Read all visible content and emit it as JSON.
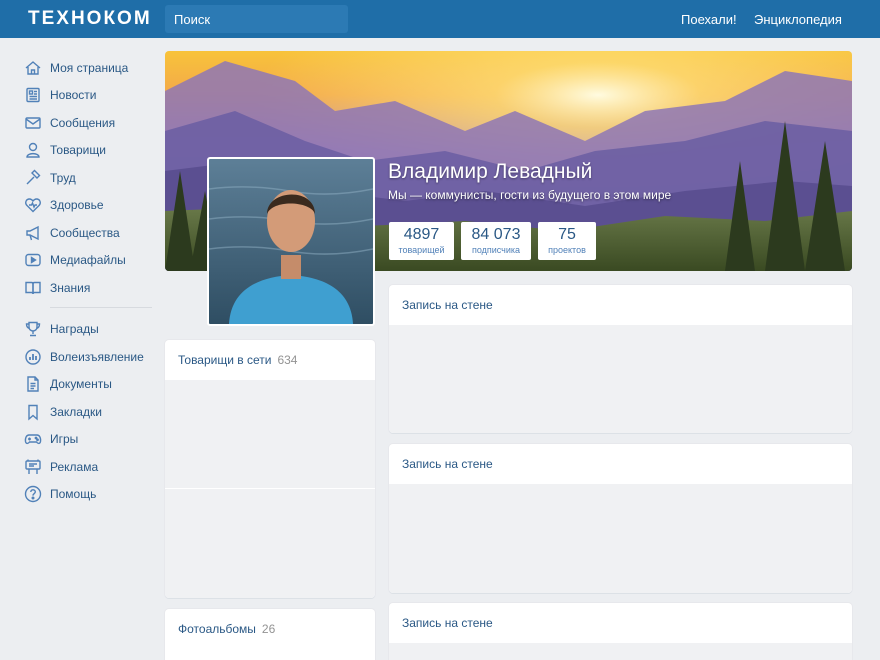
{
  "header": {
    "logo": "ТЕХНОКОМ",
    "search_placeholder": "Поиск",
    "links": [
      "Поехали!",
      "Энциклопедия"
    ]
  },
  "sidebar": {
    "items": [
      {
        "label": "Моя страница",
        "icon": "home-icon"
      },
      {
        "label": "Новости",
        "icon": "newspaper-icon"
      },
      {
        "label": "Сообщения",
        "icon": "envelope-icon"
      },
      {
        "label": "Товарищи",
        "icon": "user-icon"
      },
      {
        "label": "Труд",
        "icon": "hammer-icon"
      },
      {
        "label": "Здоровье",
        "icon": "heart-icon"
      },
      {
        "label": "Сообщества",
        "icon": "megaphone-icon"
      },
      {
        "label": "Медиафайлы",
        "icon": "play-icon"
      },
      {
        "label": "Знания",
        "icon": "book-icon"
      }
    ],
    "items2": [
      {
        "label": "Награды",
        "icon": "trophy-icon"
      },
      {
        "label": "Волеизъявление",
        "icon": "poll-icon"
      },
      {
        "label": "Документы",
        "icon": "document-icon"
      },
      {
        "label": "Закладки",
        "icon": "bookmark-icon"
      },
      {
        "label": "Игры",
        "icon": "gamepad-icon"
      },
      {
        "label": "Реклама",
        "icon": "billboard-icon"
      },
      {
        "label": "Помощь",
        "icon": "help-icon"
      }
    ]
  },
  "profile": {
    "name": "Владимир Левадный",
    "status": "Мы — коммунисты, гости из будущего в этом мире",
    "stats": [
      {
        "value": "4897",
        "label": "товарищей"
      },
      {
        "value": "84 073",
        "label": "подписчика"
      },
      {
        "value": "75",
        "label": "проектов"
      }
    ]
  },
  "friends_block": {
    "title": "Товарищи в сети",
    "count": "634"
  },
  "albums_block": {
    "title": "Фотоальбомы",
    "count": "26"
  },
  "wall": [
    {
      "title": "Запись на стене"
    },
    {
      "title": "Запись на стене"
    },
    {
      "title": "Запись на стене"
    }
  ],
  "colors": {
    "header": "#1f6ea8",
    "link": "#2a5885",
    "background": "#eceef1"
  }
}
